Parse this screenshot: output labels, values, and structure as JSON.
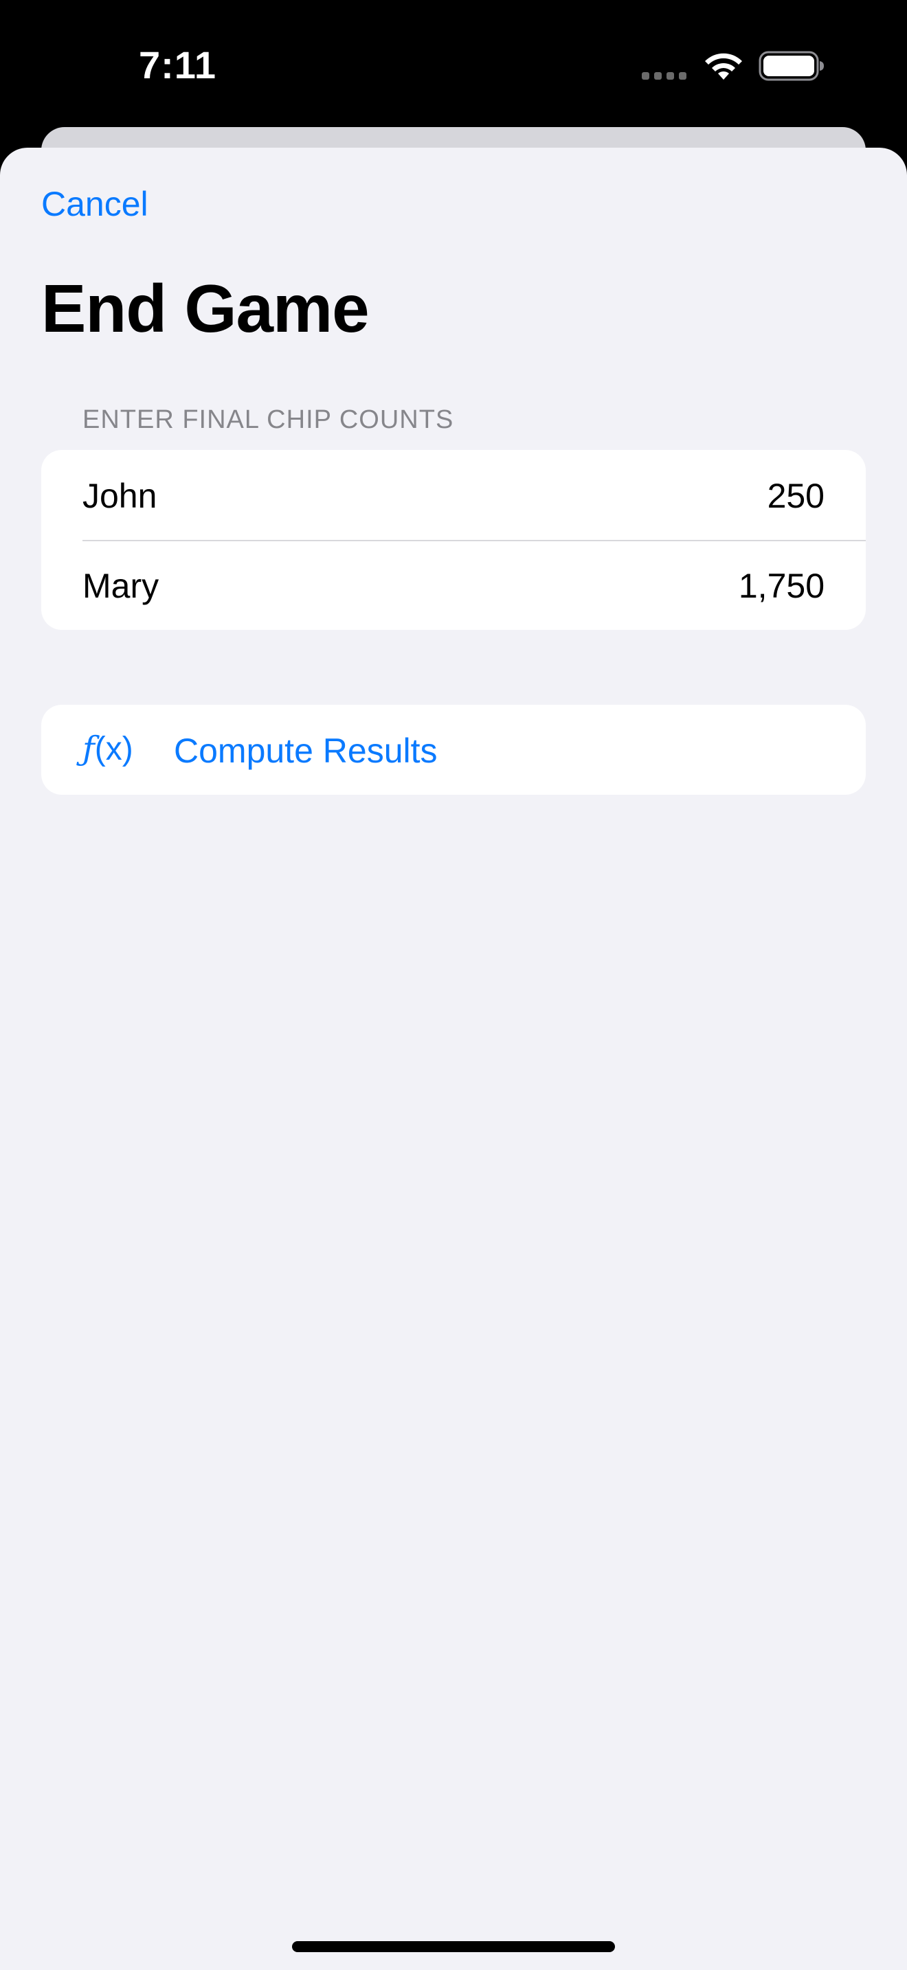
{
  "status_bar": {
    "time": "7:11",
    "icons": [
      "signal-dots-icon",
      "wifi-icon",
      "battery-icon"
    ]
  },
  "nav": {
    "cancel_label": "Cancel"
  },
  "title": "End Game",
  "chip_section": {
    "header": "ENTER FINAL CHIP COUNTS",
    "players": [
      {
        "name": "John",
        "chips": "250"
      },
      {
        "name": "Mary",
        "chips": "1,750"
      }
    ]
  },
  "compute": {
    "icon": "function-icon",
    "label": "Compute Results"
  },
  "colors": {
    "accent": "#0a7aff",
    "background": "#f2f2f7",
    "card": "#ffffff",
    "secondary_text": "#86868b"
  }
}
